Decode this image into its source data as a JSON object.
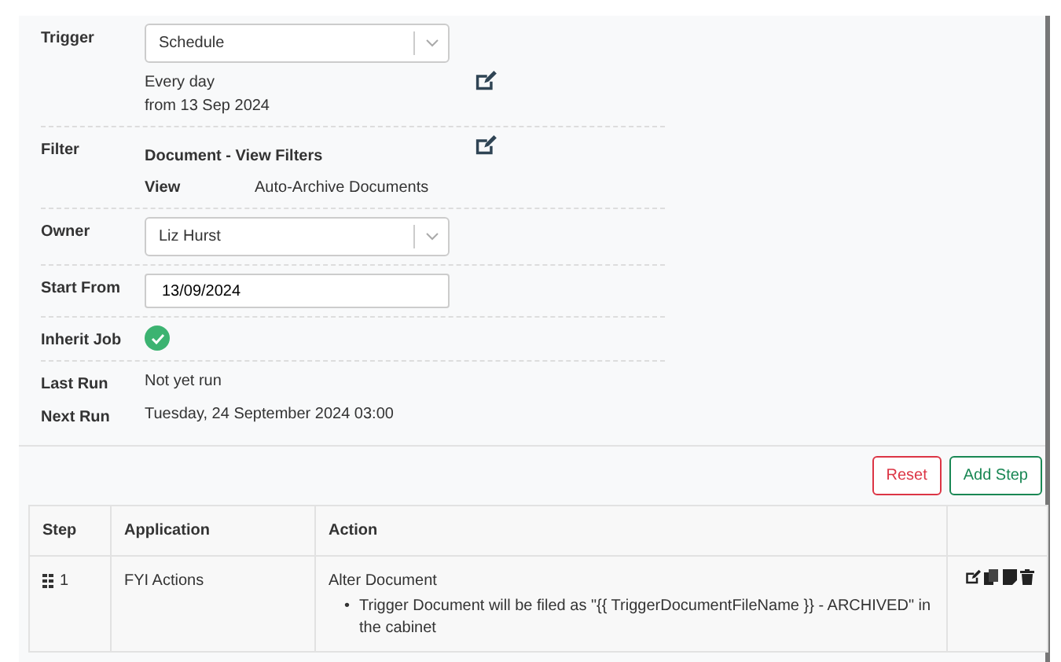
{
  "form": {
    "trigger": {
      "label": "Trigger",
      "value": "Schedule",
      "schedule_lines": [
        "Every day",
        "from 13 Sep 2024"
      ]
    },
    "filter": {
      "label": "Filter",
      "title": "Document - View Filters",
      "view_label": "View",
      "view_value": "Auto-Archive Documents"
    },
    "owner": {
      "label": "Owner",
      "value": "Liz Hurst"
    },
    "start_from": {
      "label": "Start From",
      "value": "13/09/2024"
    },
    "inherit_job": {
      "label": "Inherit Job",
      "checked": true
    },
    "last_run": {
      "label": "Last Run",
      "value": "Not yet run"
    },
    "next_run": {
      "label": "Next Run",
      "value": "Tuesday, 24 September 2024 03:00"
    }
  },
  "buttons": [
    {
      "label": "Reset",
      "kind": "danger"
    },
    {
      "label": "Add Step",
      "kind": "success"
    }
  ],
  "steps_table": {
    "columns": [
      "Step",
      "Application",
      "Action"
    ],
    "rows": [
      {
        "step": "1",
        "application": "FYI Actions",
        "action": "Alter Document",
        "bullet": "•",
        "details": [
          "Trigger Document will be filed as \"{{ TriggerDocumentFileName }} - ARCHIVED\" in the cabinet"
        ]
      }
    ]
  }
}
